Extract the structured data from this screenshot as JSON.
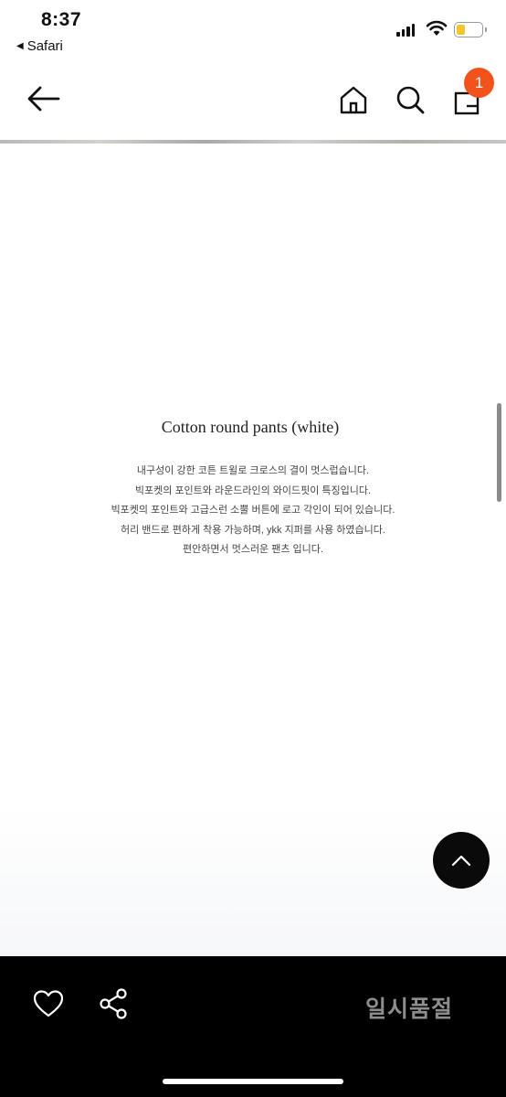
{
  "status_bar": {
    "time": "8:37",
    "back_app": "Safari",
    "battery_color": "#f2c72e"
  },
  "header": {
    "back_icon": "arrow-left-icon",
    "home_icon": "home-icon",
    "search_icon": "search-icon",
    "bag_icon": "shopping-bag-icon",
    "cart_count": "1",
    "badge_color": "#f2531c"
  },
  "product": {
    "title": "Cotton round pants (white)",
    "description": [
      "내구성이 강한 코튼 트윌로 크로스의 결이 멋스럽습니다.",
      "빅포켓의 포인트와 라운드라인의 와이드핏이 특징입니다.",
      "빅포켓의 포인트와 고급스런 소뿔 버튼에 로고 각인이 되어 있습니다.",
      "허리 밴드로 편하게 착용 가능하며, ykk 지퍼를 사용 하였습니다.",
      "편안하면서 멋스러운 팬츠 입니다."
    ]
  },
  "floating": {
    "scroll_top_icon": "chevron-up-icon"
  },
  "bottom_bar": {
    "like_icon": "heart-icon",
    "share_icon": "share-icon",
    "status_label": "일시품절"
  }
}
